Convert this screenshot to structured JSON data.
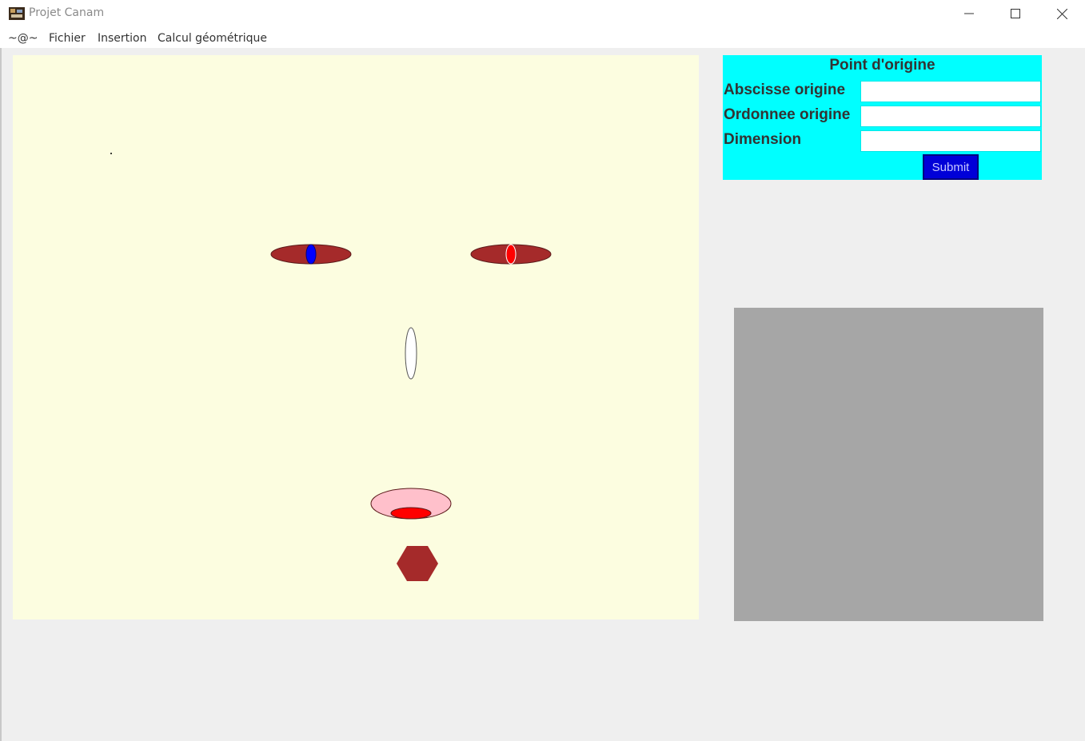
{
  "window": {
    "title": "Projet Canam"
  },
  "menu": {
    "items": [
      {
        "label": "~@~"
      },
      {
        "label": "Fichier"
      },
      {
        "label": "Insertion"
      },
      {
        "label": "Calcul géométrique"
      }
    ]
  },
  "form": {
    "title": "Point d'origine",
    "fields": [
      {
        "label": "Abscisse origine",
        "value": ""
      },
      {
        "label": "Ordonnee origine",
        "value": ""
      },
      {
        "label": "Dimension",
        "value": ""
      }
    ],
    "submit_label": "Submit"
  },
  "colors": {
    "canvas_bg": "#fcfde0",
    "form_bg": "#00ffff",
    "eye_fill": "#a52a2a",
    "left_pupil": "#0000ff",
    "right_pupil": "#ff0000",
    "nose_fill": "#ffffff",
    "mouth_outer": "#ffc0cb",
    "mouth_inner": "#ff0000",
    "chin_fill": "#a52a2a",
    "preview_bg": "#a6a6a6"
  }
}
